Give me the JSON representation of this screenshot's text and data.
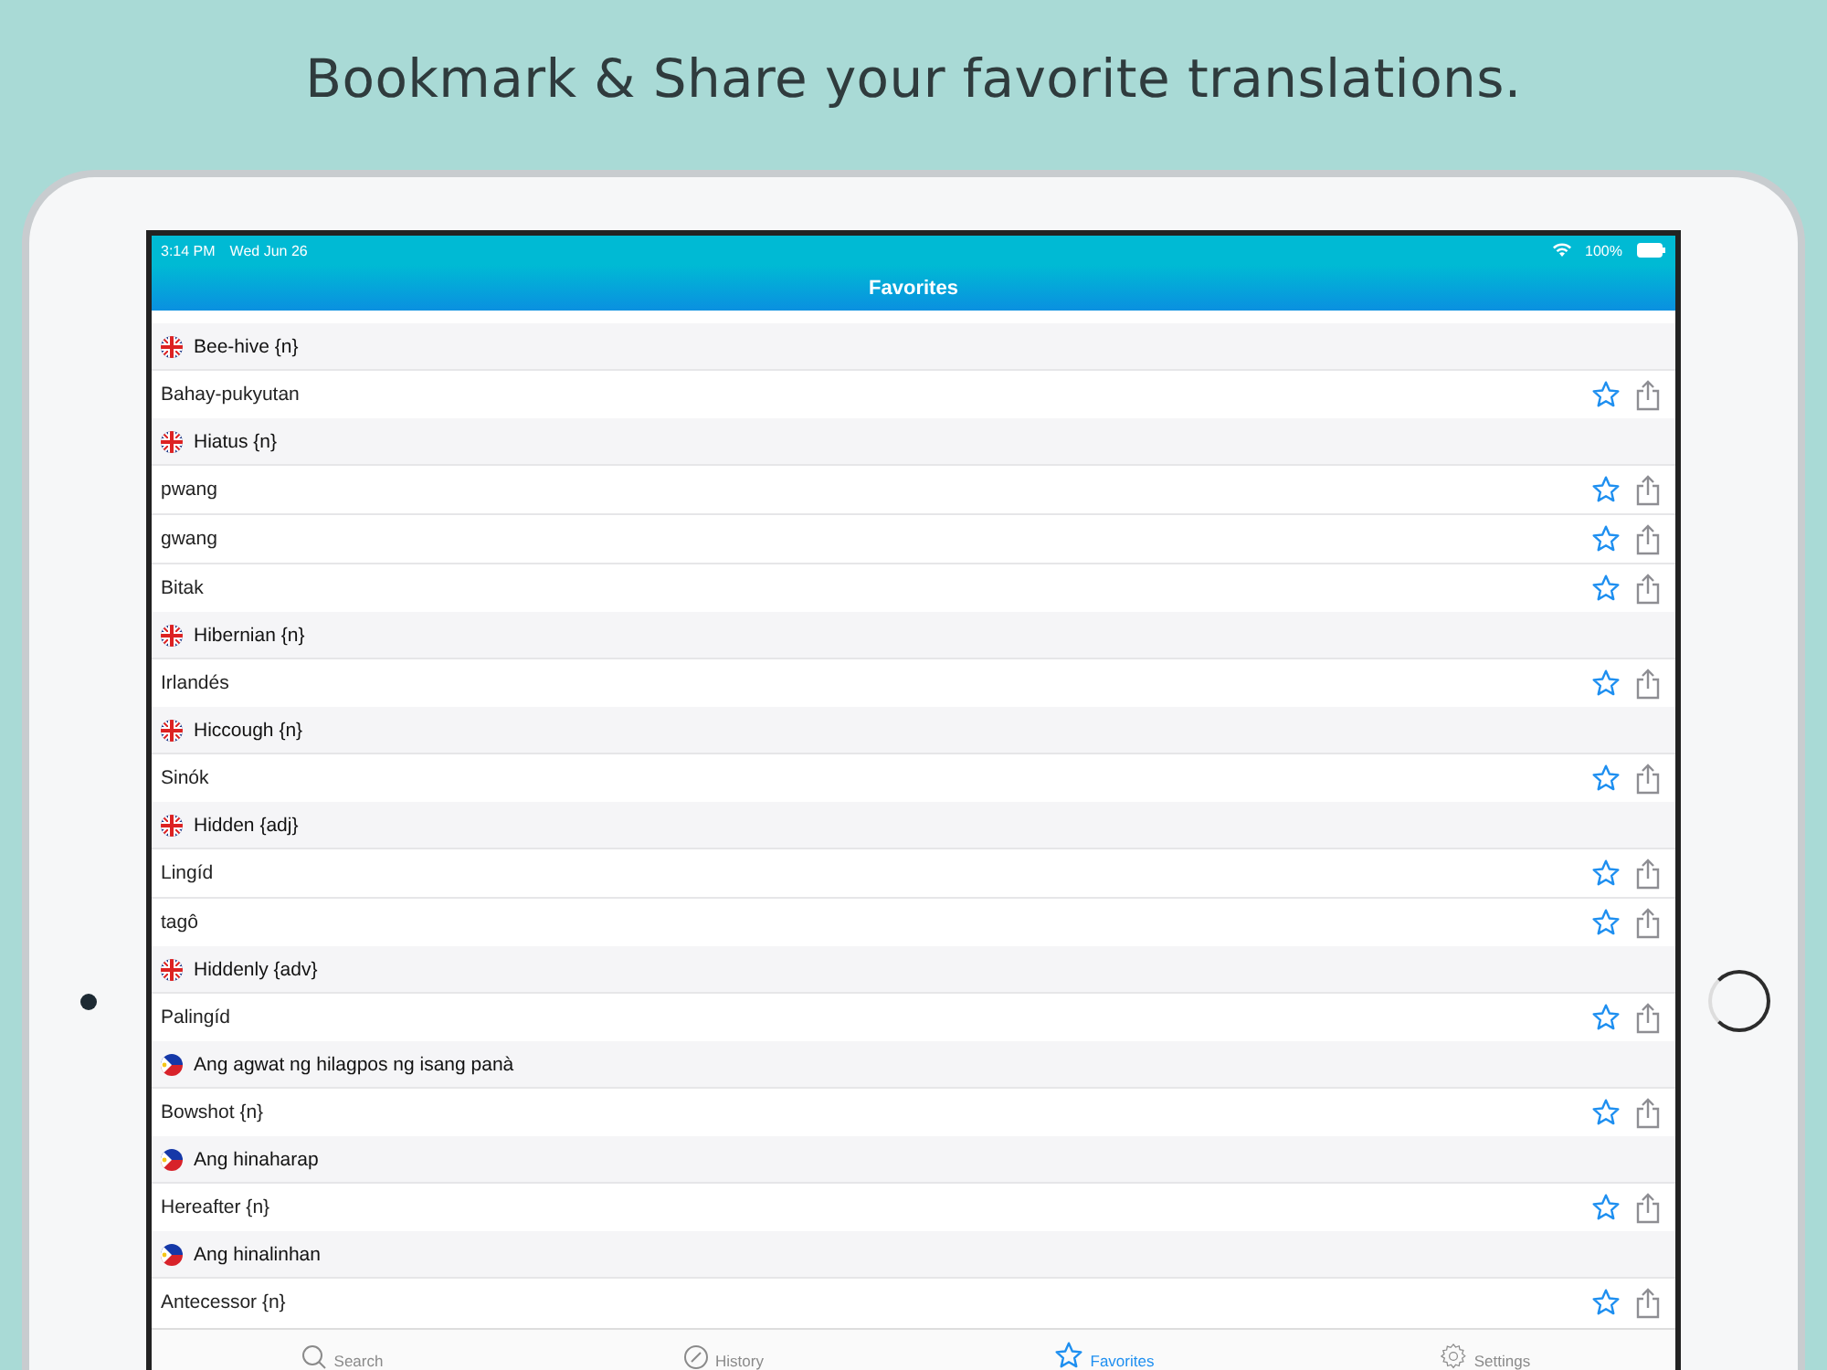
{
  "headline": "Bookmark & Share your favorite translations.",
  "status_bar": {
    "time": "3:14 PM",
    "date": "Wed Jun 26",
    "battery": "100%"
  },
  "nav": {
    "title": "Favorites"
  },
  "groups": [
    {
      "kind": "uk",
      "term": "Bee-hive {n}",
      "translations": [
        "Bahay-pukyutan"
      ]
    },
    {
      "kind": "uk",
      "term": "Hiatus {n}",
      "translations": [
        "pwang",
        "gwang",
        "Bitak"
      ]
    },
    {
      "kind": "uk",
      "term": "Hibernian {n}",
      "translations": [
        "Irlandés"
      ]
    },
    {
      "kind": "uk",
      "term": "Hiccough {n}",
      "translations": [
        "Sinók"
      ]
    },
    {
      "kind": "uk",
      "term": "Hidden {adj}",
      "translations": [
        "Lingíd",
        "tagô"
      ]
    },
    {
      "kind": "uk",
      "term": "Hiddenly {adv}",
      "translations": [
        "Palingíd"
      ]
    },
    {
      "kind": "ph",
      "term": "Ang agwat ng hilagpos ng isang panà",
      "translations": [
        "Bowshot {n}"
      ]
    },
    {
      "kind": "ph",
      "term": "Ang hinaharap",
      "translations": [
        "Hereafter {n}"
      ]
    },
    {
      "kind": "ph",
      "term": "Ang hinalinhan",
      "translations": [
        "Antecessor {n}"
      ]
    }
  ],
  "tabs": [
    {
      "kind": "search",
      "label": "Search",
      "selected": false
    },
    {
      "kind": "history",
      "label": "History",
      "selected": false
    },
    {
      "kind": "favorites",
      "label": "Favorites",
      "selected": true
    },
    {
      "kind": "settings",
      "label": "Settings",
      "selected": false
    }
  ]
}
